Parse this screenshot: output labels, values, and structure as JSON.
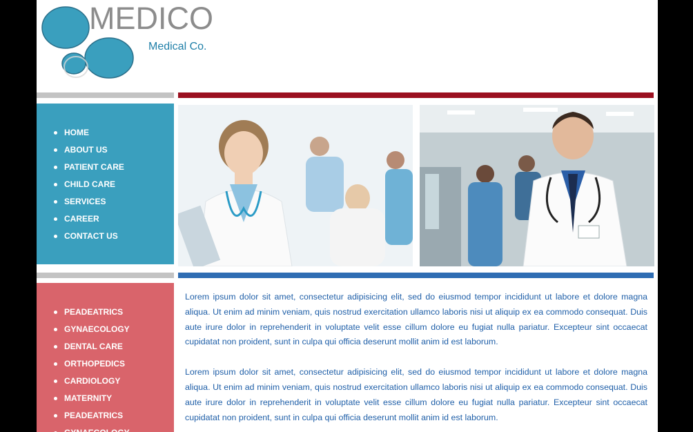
{
  "brand": {
    "name": "MEDICO",
    "tagline": "Medical Co."
  },
  "colors": {
    "accent_blue": "#3a9fbe",
    "accent_red": "#d9646b",
    "separator_dark_red": "#9b1020",
    "separator_blue": "#2f6db3",
    "text_blue": "#1f5fa8"
  },
  "nav_main": {
    "items": [
      "HOME",
      "ABOUT US",
      "PATIENT CARE",
      "CHILD CARE",
      "SERVICES",
      "CAREER",
      "CONTACT US"
    ]
  },
  "nav_departments": {
    "items": [
      "PEADEATRICS",
      "GYNAECOLOGY",
      "DENTAL CARE",
      "ORTHOPEDICS",
      "CARDIOLOGY",
      "MATERNITY",
      "PEADEATRICS",
      "GYNAECOLOGY"
    ]
  },
  "content": {
    "paragraphs": [
      "Lorem ipsum dolor sit amet, consectetur adipisicing elit, sed do eiusmod tempor incididunt ut labore et dolore magna aliqua. Ut enim ad minim veniam, quis nostrud exercitation ullamco laboris nisi ut aliquip ex ea commodo consequat. Duis aute irure dolor in reprehenderit in voluptate velit esse cillum dolore eu fugiat nulla pariatur. Excepteur sint occaecat cupidatat non proident, sunt in culpa qui officia deserunt mollit anim id est laborum.",
      "Lorem ipsum dolor sit amet, consectetur adipisicing elit, sed do eiusmod tempor incididunt ut labore et dolore magna aliqua. Ut enim ad minim veniam, quis nostrud exercitation ullamco laboris nisi ut aliquip ex ea commodo consequat. Duis aute irure dolor in reprehenderit in voluptate velit esse cillum dolore eu fugiat nulla pariatur. Excepteur sint occaecat cupidatat non proident, sunt in culpa qui officia deserunt mollit anim id est laborum."
    ]
  },
  "images": {
    "photo1": "female-doctor-photo",
    "photo2": "male-doctor-photo"
  }
}
